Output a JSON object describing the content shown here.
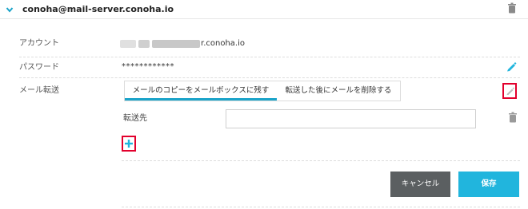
{
  "account": {
    "title": "conoha@mail-server.conoha.io"
  },
  "fields": {
    "account_label": "アカウント",
    "account_value_suffix": "r.conoha.io",
    "password_label": "パスワード",
    "password_value": "************",
    "forward_label": "メール転送"
  },
  "forward": {
    "options": [
      {
        "label": "メールのコピーをメールボックスに残す",
        "selected": true
      },
      {
        "label": "転送した後にメールを削除する",
        "selected": false
      }
    ],
    "destination_label": "転送先",
    "destination_value": ""
  },
  "buttons": {
    "cancel": "キャンセル",
    "save": "保存"
  },
  "colors": {
    "accent": "#21b5dd",
    "segment_underline": "#1aa3c9",
    "cancel_bg": "#5b5f61",
    "highlight_border": "#e2002d",
    "header_chevron": "#1aa3c9"
  },
  "icons": {
    "header_toggle": "chevron-down-icon",
    "delete_account": "trash-icon",
    "edit_password": "pencil-icon",
    "edit_forward": "pencil-icon",
    "delete_forward_row": "trash-icon",
    "add_forward": "plus-icon"
  }
}
